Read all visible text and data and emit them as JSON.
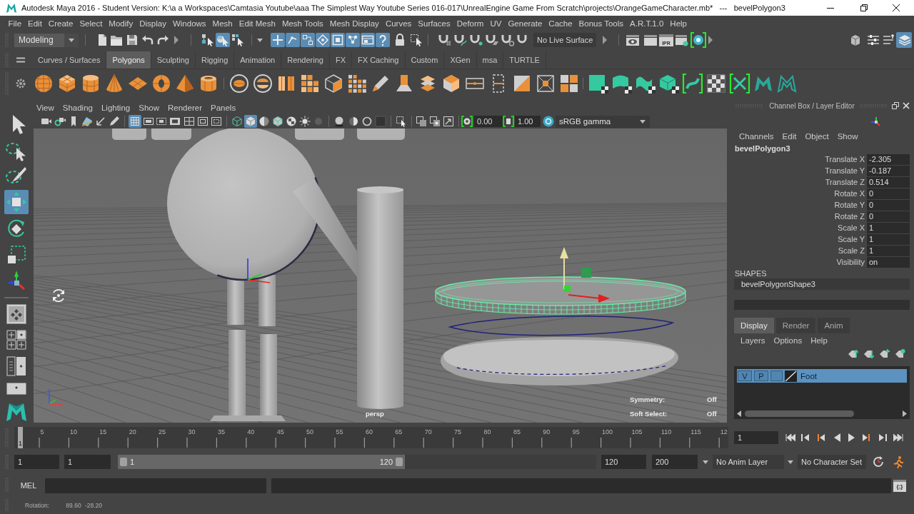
{
  "window": {
    "title": "Autodesk Maya 2016 - Student Version: K:\\a a Workspaces\\Camtasia Youtube\\aaa The Simplest Way Youtube Series 016-017\\UnrealEngine Game From Scratch\\projects\\OrangeGameCharacter.mb*   ---   bevelPolygon3"
  },
  "menu": [
    "File",
    "Edit",
    "Create",
    "Select",
    "Modify",
    "Display",
    "Windows",
    "Mesh",
    "Edit Mesh",
    "Mesh Tools",
    "Mesh Display",
    "Curves",
    "Surfaces",
    "Deform",
    "UV",
    "Generate",
    "Cache",
    "Bonus Tools",
    "A.R.T.1.0",
    "Help"
  ],
  "status_line": {
    "mode": "Modeling",
    "select_modes": [
      {
        "selected": false
      },
      {
        "selected": true
      },
      {
        "selected": false
      }
    ],
    "masks": [
      {
        "on": true
      },
      {
        "on": true
      },
      {
        "on": true
      },
      {
        "on": true
      },
      {
        "on": true
      },
      {
        "on": true
      },
      {
        "on": true
      },
      {
        "on": true
      }
    ],
    "snaps": [
      {
        "on": false
      },
      {
        "on": false
      },
      {
        "on": false
      },
      {
        "on": false
      },
      {
        "on": false
      },
      {
        "on": false
      }
    ],
    "live_surface": "No Live Surface",
    "render_label": "IPR",
    "panels": [
      {
        "on": false
      },
      {
        "on": false
      },
      {
        "on": false
      },
      {
        "on": true
      }
    ]
  },
  "shelf": {
    "tabs": [
      {
        "label": "Curves / Surfaces",
        "selected": false
      },
      {
        "label": "Polygons",
        "selected": true
      },
      {
        "label": "Sculpting",
        "selected": false
      },
      {
        "label": "Rigging",
        "selected": false
      },
      {
        "label": "Animation",
        "selected": false
      },
      {
        "label": "Rendering",
        "selected": false
      },
      {
        "label": "FX",
        "selected": false
      },
      {
        "label": "FX Caching",
        "selected": false
      },
      {
        "label": "Custom",
        "selected": false
      },
      {
        "label": "XGen",
        "selected": false
      },
      {
        "label": "msa",
        "selected": false
      },
      {
        "label": "TURTLE",
        "selected": false
      }
    ]
  },
  "toolbox": {
    "tools": [
      {
        "selected": false
      },
      {
        "selected": false
      },
      {
        "selected": false
      },
      {
        "selected": true
      },
      {
        "selected": false
      },
      {
        "selected": false
      },
      {
        "selected": false
      }
    ]
  },
  "viewport": {
    "menu": [
      "View",
      "Shading",
      "Lighting",
      "Show",
      "Renderer",
      "Panels"
    ],
    "toggles": [
      {
        "on": true
      },
      {
        "on": false
      },
      {
        "on": false
      },
      {
        "on": false
      },
      {
        "on": false
      },
      {
        "on": false
      },
      {
        "on": false
      },
      {
        "on": false
      },
      {
        "on": true
      },
      {
        "on": false
      },
      {
        "on": false
      },
      {
        "on": false
      },
      {
        "on": false
      },
      {
        "on": false
      },
      {
        "on": false
      },
      {
        "on": false
      },
      {
        "on": false
      },
      {
        "on": false
      },
      {
        "on": false
      },
      {
        "on": false
      },
      {
        "on": false
      },
      {
        "on": false
      }
    ],
    "exposure": "0.00",
    "gamma": "1.00",
    "color_space": "sRGB gamma",
    "camera": "persp",
    "hud": [
      {
        "label": "Symmetry:",
        "value": "Off"
      },
      {
        "label": "Soft Select:",
        "value": "Off"
      }
    ]
  },
  "channel_box": {
    "title": "Channel Box / Layer Editor",
    "menu": [
      "Channels",
      "Edit",
      "Object",
      "Show"
    ],
    "object": "bevelPolygon3",
    "channels": [
      {
        "name": "Translate X",
        "value": "-2.305"
      },
      {
        "name": "Translate Y",
        "value": "-0.187"
      },
      {
        "name": "Translate Z",
        "value": "0.514"
      },
      {
        "name": "Rotate X",
        "value": "0"
      },
      {
        "name": "Rotate Y",
        "value": "0"
      },
      {
        "name": "Rotate Z",
        "value": "0"
      },
      {
        "name": "Scale X",
        "value": "1"
      },
      {
        "name": "Scale Y",
        "value": "1"
      },
      {
        "name": "Scale Z",
        "value": "1"
      },
      {
        "name": "Visibility",
        "value": "on"
      }
    ],
    "shapes_heading": "SHAPES",
    "shapes": [
      "bevelPolygonShape3"
    ],
    "layer_tabs": [
      {
        "label": "Display",
        "selected": true
      },
      {
        "label": "Render",
        "selected": false
      },
      {
        "label": "Anim",
        "selected": false
      }
    ],
    "layer_menu": [
      "Layers",
      "Options",
      "Help"
    ],
    "layers": [
      {
        "visibility_label": "V",
        "playback_label": "P",
        "name": "Foot",
        "selected": true
      }
    ]
  },
  "timeline": {
    "labels": [
      "5",
      "10",
      "15",
      "20",
      "25",
      "30",
      "35",
      "40",
      "45",
      "50",
      "55",
      "60",
      "65",
      "70",
      "75",
      "80",
      "85",
      "90",
      "95",
      "100",
      "105",
      "110",
      "115",
      "12"
    ],
    "level": 0,
    "marker": "1",
    "current_frame": "1"
  },
  "range": {
    "start": "1",
    "playback_start": "1",
    "range_start": "1",
    "range_end": "120",
    "level": 0.6,
    "playback_end": "120",
    "end": "200",
    "anim_layer": "No Anim Layer",
    "character_set": "No Character Set"
  },
  "command_line": {
    "language": "MEL",
    "script_editor": "{;}"
  },
  "help_line": {
    "label": "Rotation:",
    "values": [
      "89.60",
      "-28.20"
    ]
  }
}
